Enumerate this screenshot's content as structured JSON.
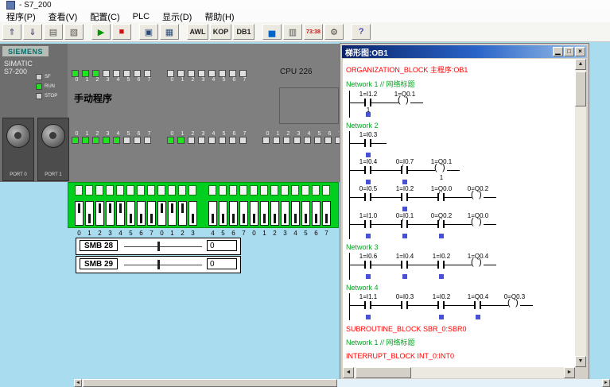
{
  "titlebar": {
    "title": "- S7_200"
  },
  "menu": {
    "items": [
      {
        "name": "menu-program",
        "label": "程序(P)"
      },
      {
        "name": "menu-view",
        "label": "查看(V)"
      },
      {
        "name": "menu-config",
        "label": "配置(C)"
      },
      {
        "name": "menu-plc",
        "label": "PLC"
      },
      {
        "name": "menu-display",
        "label": "显示(D)"
      },
      {
        "name": "menu-help",
        "label": "帮助(H)"
      }
    ]
  },
  "toolbar": {
    "buttons": [
      {
        "name": "upload-button",
        "glyph": "⇑",
        "color": "#3a3a6a"
      },
      {
        "name": "download-button",
        "glyph": "⇓",
        "color": "#3a3a6a"
      },
      {
        "name": "print-button",
        "glyph": "▤",
        "color": "#555555"
      },
      {
        "name": "clear-button",
        "glyph": "▧",
        "color": "#555555"
      },
      {
        "name": "run-button",
        "glyph": "▶",
        "color": "#009900",
        "gap": true
      },
      {
        "name": "stop-button",
        "glyph": "■",
        "color": "#cc1111"
      },
      {
        "name": "state-monitor-button",
        "glyph": "▣",
        "color": "#2a4a7a",
        "gap": true
      },
      {
        "name": "program-monitor-button",
        "glyph": "▦",
        "color": "#2a4a7a"
      },
      {
        "name": "awl-button",
        "label": "AWL",
        "gap": true
      },
      {
        "name": "kop-button",
        "label": "KOP"
      },
      {
        "name": "db1-button",
        "label": "DB1"
      },
      {
        "name": "chart-button",
        "glyph": "▅",
        "color": "#0066cc",
        "gap": true
      },
      {
        "name": "io-table-button",
        "glyph": "▥",
        "color": "#555555"
      },
      {
        "name": "timer-button",
        "label": "73:38",
        "small": true,
        "color": "#cc1111"
      },
      {
        "name": "settings-button",
        "glyph": "⚙",
        "color": "#444444"
      },
      {
        "name": "help-button",
        "glyph": "?",
        "color": "#000099",
        "gap": true
      }
    ]
  },
  "simulator": {
    "brand": "SIEMENS",
    "model_line1": "SIMATIC",
    "model_line2": "S7-200",
    "status_leds": [
      {
        "label": "SF",
        "on": false
      },
      {
        "label": "RUN",
        "on": true
      },
      {
        "label": "STOP",
        "on": false
      }
    ],
    "program_label": "手动程序",
    "cpu_label": "CPU 226",
    "digits": [
      "0",
      "1",
      "2",
      "3",
      "4",
      "5",
      "6",
      "7"
    ],
    "output_led_groups": [
      [
        1,
        1,
        1,
        0,
        0,
        0,
        0,
        0
      ],
      [
        0,
        0,
        0,
        0,
        0,
        0,
        0,
        0
      ]
    ],
    "input_led_groups": [
      [
        1,
        1,
        1,
        1,
        1,
        0,
        0,
        0
      ],
      [
        1,
        1,
        0,
        0,
        0,
        0,
        0,
        0
      ],
      [
        0,
        0,
        0,
        0,
        0,
        0,
        0,
        0
      ]
    ],
    "ports": [
      {
        "label": "PORT 0"
      },
      {
        "label": "PORT 1"
      }
    ],
    "switches": [
      1,
      0,
      1,
      1,
      1,
      0,
      0,
      0,
      1,
      1,
      1,
      0,
      0,
      0,
      0,
      0,
      0,
      0,
      0,
      0,
      0,
      0,
      0,
      0
    ]
  },
  "smb": {
    "rows": [
      {
        "label": "SMB 28",
        "value": "0"
      },
      {
        "label": "SMB 29",
        "value": "0"
      }
    ]
  },
  "ladder": {
    "title": "梯形图:OB1",
    "window_buttons": [
      {
        "name": "minimize-button",
        "glyph": "▁"
      },
      {
        "name": "maximize-button",
        "glyph": "□"
      },
      {
        "name": "close-button",
        "glyph": "×"
      }
    ],
    "sections": [
      {
        "type": "header",
        "text": "ORGANIZATION_BLOCK 主程序:OB1"
      },
      {
        "type": "network",
        "title": "Network 1 // 网络标题",
        "rungs": [
          [
            {
              "t": "contact",
              "label": "1=I1.2",
              "sub": "1",
              "mark": true
            },
            {
              "t": "coil",
              "label": "1=Q0.1"
            }
          ]
        ]
      },
      {
        "type": "network",
        "title": "Network 2",
        "rungs": [
          [
            {
              "t": "contact",
              "label": "1=I0.3",
              "mark": true
            }
          ],
          [
            {
              "t": "contact",
              "label": "1=I0.4",
              "mark": true
            },
            {
              "t": "ncontact",
              "label": "0=I0.7",
              "mark": true
            },
            {
              "t": "coil",
              "label": "1=Q0.1",
              "sub": "1"
            }
          ],
          [
            {
              "t": "contact",
              "label": "0=I0.5"
            },
            {
              "t": "contact",
              "label": "1=I0.2",
              "mark": true
            },
            {
              "t": "ncontact",
              "label": "1=Q0.0"
            },
            {
              "t": "coil",
              "label": "0=Q0.2"
            }
          ],
          [
            {
              "t": "contact",
              "label": "1=I1.0",
              "mark": true
            },
            {
              "t": "ncontact",
              "label": "0=I0.1",
              "mark": true
            },
            {
              "t": "ncontact",
              "label": "0=Q0.2",
              "mark": true
            },
            {
              "t": "coil",
              "label": "1=Q0.0"
            }
          ]
        ]
      },
      {
        "type": "network",
        "title": "Network 3",
        "rungs": [
          [
            {
              "t": "contact",
              "label": "1=I0.6",
              "mark": true
            },
            {
              "t": "contact",
              "label": "1=I0.4",
              "mark": true
            },
            {
              "t": "contact",
              "label": "1=I0.2",
              "mark": true
            },
            {
              "t": "coil",
              "label": "1=Q0.4"
            }
          ]
        ]
      },
      {
        "type": "network",
        "title": "Network 4",
        "rungs": [
          [
            {
              "t": "contact",
              "label": "1=I1.1",
              "mark": true
            },
            {
              "t": "contact",
              "label": "0=I0.3"
            },
            {
              "t": "contact",
              "label": "1=I0.2",
              "mark": true
            },
            {
              "t": "contact",
              "label": "1=Q0.4",
              "mark": true
            },
            {
              "t": "coil",
              "label": "0=Q0.3"
            }
          ]
        ]
      },
      {
        "type": "header",
        "text": "SUBROUTINE_BLOCK SBR_0:SBR0"
      },
      {
        "type": "network",
        "title": "Network 1 // 网络标题",
        "rungs": []
      },
      {
        "type": "header",
        "text": "INTERRUPT_BLOCK INT_0:INT0"
      }
    ]
  },
  "scroll": {
    "up": "▲",
    "down": "▼",
    "left": "◄",
    "right": "►"
  },
  "colors": {
    "desktop": "#aadcf0",
    "header_red": "#ff0000",
    "network_green": "#00a81e",
    "power_mark": "#4850d8",
    "led_on": "#21e421",
    "terminal_green": "#00cf1f",
    "run_green": "#009900",
    "stop_red": "#cc1111",
    "titlebar_blue": "#0a246a"
  }
}
